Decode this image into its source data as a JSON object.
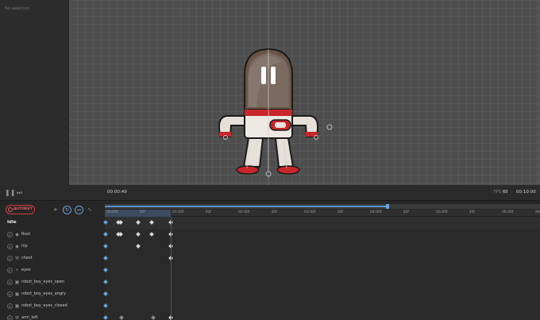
{
  "left_panel": {
    "selection_text": "No selection"
  },
  "viewport": {
    "background": "#4e4e4e",
    "character": "robot_boy"
  },
  "toolbar": {
    "play_icon": "pause-icon",
    "step_icon": "step-end-icon",
    "current_time": "00:00:49",
    "fps_label": "FPS",
    "fps_value": "60",
    "total_time": "00:10:00"
  },
  "controls": {
    "autokey_label": "AUTOKEY",
    "cursor_icon": "cursor-icon",
    "btn1_icon": "loop-icon",
    "btn2_icon": "fit-icon",
    "curve_icon": "curve-icon"
  },
  "scrubber": {
    "progress": 0.65
  },
  "ruler": {
    "labels": [
      "00:00f",
      "30f",
      "01:00f",
      "30f",
      "02:00f",
      "30f",
      "03:00f",
      "30f",
      "04:00f",
      "30f",
      "05:00f",
      "30f",
      "06:00f",
      "30f"
    ]
  },
  "timeline": {
    "animation_name": "Idle",
    "tracks": [
      {
        "label": "Root",
        "icon": "bone-icon"
      },
      {
        "label": "hip",
        "icon": "bone-icon"
      },
      {
        "label": "chest",
        "icon": "wrench-icon"
      },
      {
        "label": "eyes",
        "icon": "bone-small-icon"
      },
      {
        "label": "robot_boy_eyes_open",
        "icon": "image-icon"
      },
      {
        "label": "robot_boy_eyes_angry",
        "icon": "image-icon"
      },
      {
        "label": "robot_boy_eyes_closed",
        "icon": "image-icon"
      },
      {
        "label": "arm_left",
        "icon": "wrench-icon"
      }
    ]
  },
  "colors": {
    "accent": "#6fa3e0",
    "autokey": "#d63c3c",
    "robot_red": "#c8262a"
  }
}
